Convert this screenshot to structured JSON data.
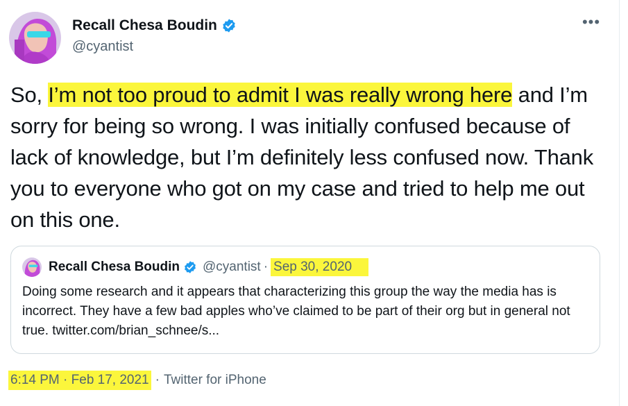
{
  "author": {
    "name": "Recall Chesa Boudin",
    "handle": "@cyantist",
    "verified_icon": "verified-badge-icon"
  },
  "more_label": "•••",
  "tweet": {
    "before": "So, ",
    "highlighted": "I’m not too proud to admit I was really wrong here",
    "after": " and I’m sorry for being so wrong. I was initially confused because of lack of knowledge, but I’m definitely less confused now. Thank you to everyone who got on my case and tried to help me out on this one."
  },
  "quote": {
    "name": "Recall Chesa Boudin",
    "handle": "@cyantist",
    "separator": "·",
    "date": "Sep 30, 2020",
    "text": "Doing some research and it appears that characterizing this group the way the media has is incorrect. They have a few bad apples who’ve claimed to be part of their org but in general not true. twitter.com/brian_schnee/s..."
  },
  "meta": {
    "timestamp": "6:14 PM · Feb 17, 2021",
    "separator": "·",
    "source": "Twitter for iPhone"
  },
  "colors": {
    "highlight": "#fbf63c",
    "verified": "#1d9bf0",
    "secondary_text": "#536471"
  }
}
